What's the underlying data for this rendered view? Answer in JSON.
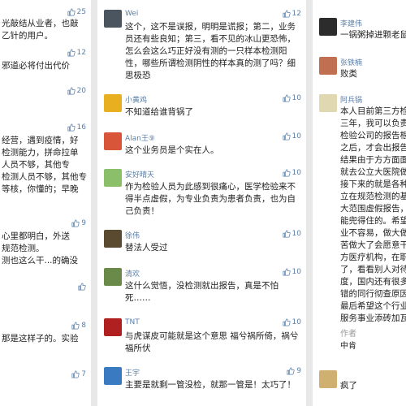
{
  "left": {
    "items": [
      {
        "text": "光敲结从业者，也敲\n乙针的用户。",
        "likes": "25"
      },
      {
        "text": "邪道必将付出代价",
        "likes": "12"
      },
      {
        "text": "",
        "likes": "20"
      },
      {
        "text": "经营，遇到疫情，好\n检测能力，拼命拉单\n人员不够，其他专\n检测人员不够，其他专\n等核，你懂的；早晚",
        "likes": "16"
      },
      {
        "text": "心里都明白，外送\n规范检测。\n测也这么干...的确没",
        "likes": "9"
      },
      {
        "text": "",
        "likes": ""
      },
      {
        "text": "那是这样子的。实验",
        "likes": "8"
      },
      {
        "text": "",
        "likes": "7"
      }
    ]
  },
  "middle": {
    "items": [
      {
        "name": "Wei",
        "likes": "12",
        "text": "这个，这不是误报，明明是谎报；第二，业务员还有些良知；第三，看不见的冰山更恐怖，怎么会这么巧正好没有测的一只样本检测阳性，哪些所谓检测阴性的样本真的测了吗？细思极恐"
      },
      {
        "name": "小黄鸡",
        "likes": "10",
        "text": "不知道给谁背锅了"
      },
      {
        "name": "Alan王⑨",
        "likes": "10",
        "text": "这个业务员是个实在人。"
      },
      {
        "name": "安好晴天",
        "likes": "10",
        "text": "作为检验人员为此感到很痛心，医学检验来不得半点虚假，为专业负责为患者负责，也为自己负责！"
      },
      {
        "name": "徐伟",
        "likes": "10",
        "text": "替法人受过"
      },
      {
        "name": "清欢",
        "likes": "10",
        "text": "这什么觉悟，没检测就出报告，真是不怕死……"
      },
      {
        "name": "TNT",
        "likes": "10",
        "text": "与虎谋皮可能就是这个意思 福兮祸所倚，祸兮福所伏"
      },
      {
        "name": "王宇",
        "likes": "9",
        "text": "主要是就剩一管没检，就那一管是！太巧了！"
      }
    ]
  },
  "right": {
    "items": [
      {
        "name": "李建伟",
        "text": "一锅粥掉进颗老鼠"
      },
      {
        "name": "张铁楠",
        "text": "败类"
      },
      {
        "name": "阿兵锅",
        "text": "本人目前第三方检\n三年，我可以负责\n检验公司的报告根\n之后，才会出报告\n结果由于方方面面\n就去公立大医院做\n接下来的就是各种\n立在规范检测的基\n大范围虚假报告，\n能兜得住的。希望\n业不容易，做大做\n苦做大了会愿意干\n方医疗机构，在职\n了，看看别人对待\n度，国内还有很多\n错的同行彻查原因\n最后希望这个行业\n服务事业添砖加瓦"
      },
      {
        "author_tag": "作者",
        "author_reply": "中肯"
      },
      {
        "name": "",
        "text": "疯了"
      }
    ]
  },
  "colors": {
    "name": "#5a7fa8",
    "text": "#222222",
    "tag": "#999999",
    "bg": "#e8e8e8"
  },
  "icons": {
    "like": "thumbs-up-icon"
  }
}
